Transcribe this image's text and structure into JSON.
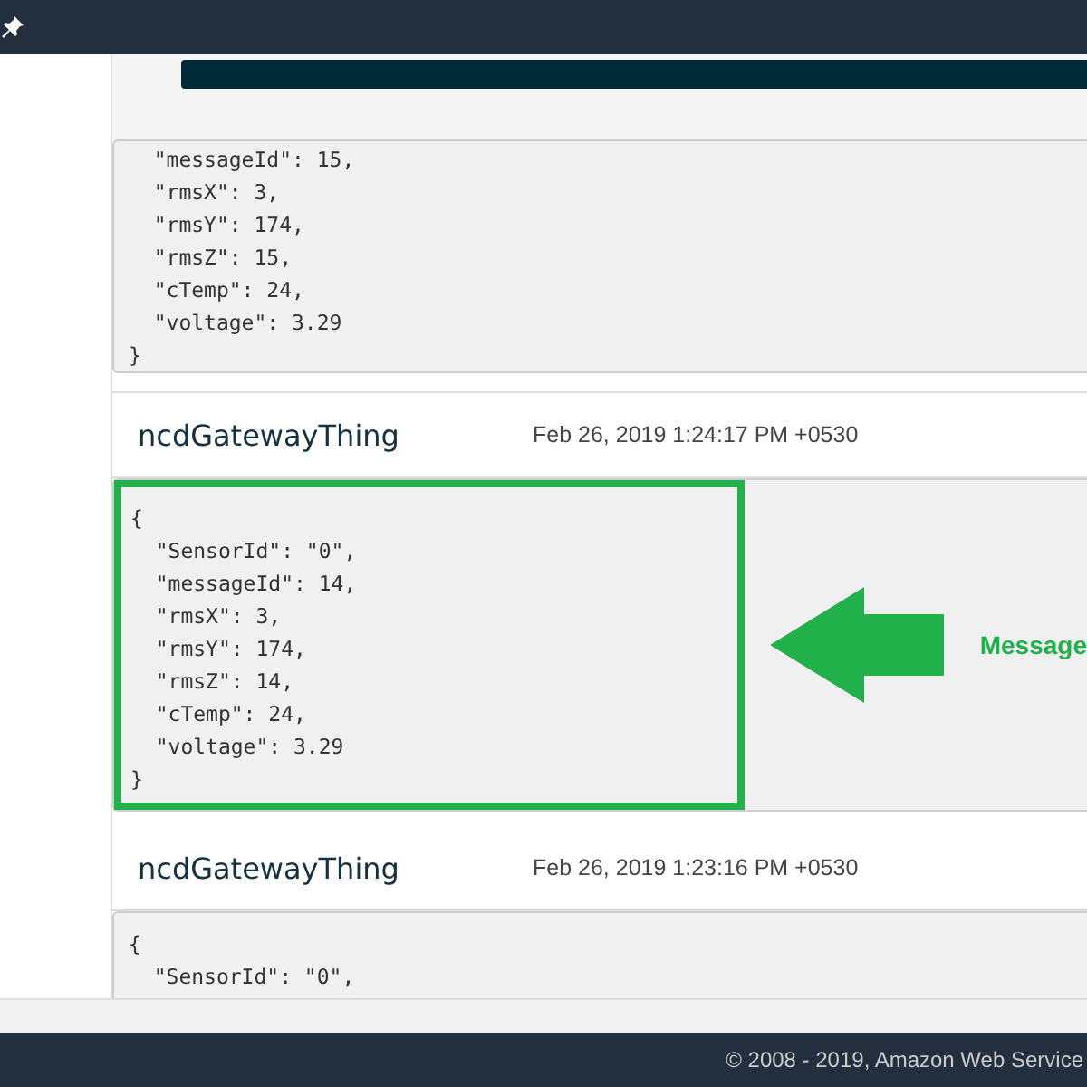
{
  "messages": [
    {
      "code": [
        "  \"messageId\": 15,",
        "  \"rmsX\": 3,",
        "  \"rmsY\": 174,",
        "  \"rmsZ\": 15,",
        "  \"cTemp\": 24,",
        "  \"voltage\": 3.29",
        "}"
      ],
      "highlighted": false
    },
    {
      "thing": "ncdGatewayThing",
      "timestamp": "Feb 26, 2019 1:24:17 PM +0530",
      "code": [
        "{",
        "  \"SensorId\": \"0\",",
        "  \"messageId\": 14,",
        "  \"rmsX\": 3,",
        "  \"rmsY\": 174,",
        "  \"rmsZ\": 14,",
        "  \"cTemp\": 24,",
        "  \"voltage\": 3.29",
        "}"
      ],
      "highlighted": true,
      "annotation": "Message"
    },
    {
      "thing": "ncdGatewayThing",
      "timestamp": "Feb 26, 2019 1:23:16 PM +0530",
      "code": [
        "{",
        "  \"SensorId\": \"0\","
      ],
      "highlighted": false
    }
  ],
  "footer": "© 2008 - 2019, Amazon Web Service"
}
